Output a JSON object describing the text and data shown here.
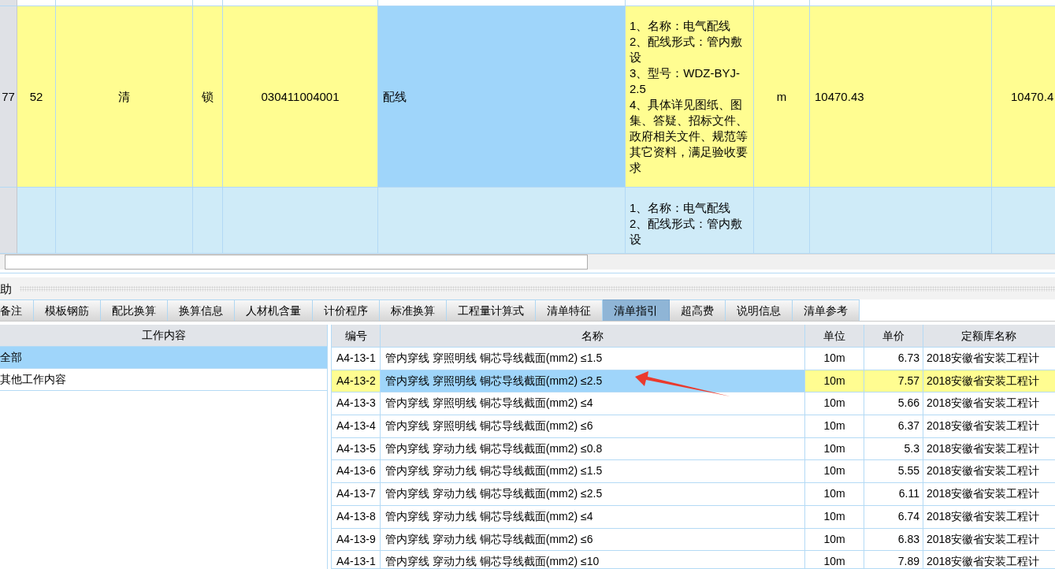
{
  "bill_rows": [
    {
      "row_number": "77",
      "current": true,
      "column_5_focused": true,
      "column_1": "52",
      "column_2": "清",
      "column_3": "锁",
      "column_4": "030411004001",
      "column_5": "配线",
      "column_6": [
        "1、名称：电气配线",
        "2、配线形式：管内敷设",
        "3、型号：WDZ-BYJ-2.5",
        "4、具体详见图纸、图集、答疑、招标文件、政府相关文件、规范等其它资料，满足验收要求"
      ],
      "column_7": "m",
      "column_8": "10470.43",
      "column_9": "10470.4"
    },
    {
      "current": false,
      "column_5_focused": false,
      "column_6": [
        "1、名称：电气配线",
        "2、配线形式：管内敷设"
      ]
    }
  ],
  "assist_panel": {
    "title": "助",
    "tabs": [
      {
        "label": "备注",
        "selected": false
      },
      {
        "label": "模板钢筋",
        "selected": false
      },
      {
        "label": "配比换算",
        "selected": false
      },
      {
        "label": "换算信息",
        "selected": false
      },
      {
        "label": "人材机含量",
        "selected": false
      },
      {
        "label": "计价程序",
        "selected": false
      },
      {
        "label": "标准换算",
        "selected": false
      },
      {
        "label": "工程量计算式",
        "selected": false
      },
      {
        "label": "清单特征",
        "selected": false
      },
      {
        "label": "清单指引",
        "selected": true
      },
      {
        "label": "超高费",
        "selected": false
      },
      {
        "label": "说明信息",
        "selected": false
      },
      {
        "label": "清单参考",
        "selected": false
      }
    ]
  },
  "work_content": {
    "header": "工作内容",
    "items": [
      {
        "label": "全部",
        "selected": true
      },
      {
        "label": "其他工作内容",
        "selected": false
      }
    ]
  },
  "quota_table": {
    "columns": [
      "编号",
      "名称",
      "单位",
      "单价",
      "定额库名称"
    ],
    "rows": [
      {
        "code": "A4-13-1",
        "name": "管内穿线 穿照明线 铜芯导线截面(mm2) ≤1.5",
        "unit": "10m",
        "price": "6.73",
        "library": "2018安徽省安装工程计",
        "selected": false,
        "name_focused": false
      },
      {
        "code": "A4-13-2",
        "name": "管内穿线 穿照明线 铜芯导线截面(mm2) ≤2.5",
        "unit": "10m",
        "price": "7.57",
        "library": "2018安徽省安装工程计",
        "selected": true,
        "name_focused": true
      },
      {
        "code": "A4-13-3",
        "name": "管内穿线 穿照明线 铜芯导线截面(mm2) ≤4",
        "unit": "10m",
        "price": "5.66",
        "library": "2018安徽省安装工程计",
        "selected": false,
        "name_focused": false
      },
      {
        "code": "A4-13-4",
        "name": "管内穿线 穿照明线 铜芯导线截面(mm2) ≤6",
        "unit": "10m",
        "price": "6.37",
        "library": "2018安徽省安装工程计",
        "selected": false,
        "name_focused": false
      },
      {
        "code": "A4-13-5",
        "name": "管内穿线 穿动力线 铜芯导线截面(mm2) ≤0.8",
        "unit": "10m",
        "price": "5.3",
        "library": "2018安徽省安装工程计",
        "selected": false,
        "name_focused": false
      },
      {
        "code": "A4-13-6",
        "name": "管内穿线 穿动力线 铜芯导线截面(mm2) ≤1.5",
        "unit": "10m",
        "price": "5.55",
        "library": "2018安徽省安装工程计",
        "selected": false,
        "name_focused": false
      },
      {
        "code": "A4-13-7",
        "name": "管内穿线 穿动力线 铜芯导线截面(mm2) ≤2.5",
        "unit": "10m",
        "price": "6.11",
        "library": "2018安徽省安装工程计",
        "selected": false,
        "name_focused": false
      },
      {
        "code": "A4-13-8",
        "name": "管内穿线 穿动力线 铜芯导线截面(mm2) ≤4",
        "unit": "10m",
        "price": "6.74",
        "library": "2018安徽省安装工程计",
        "selected": false,
        "name_focused": false
      },
      {
        "code": "A4-13-9",
        "name": "管内穿线 穿动力线 铜芯导线截面(mm2) ≤6",
        "unit": "10m",
        "price": "6.83",
        "library": "2018安徽省安装工程计",
        "selected": false,
        "name_focused": false
      },
      {
        "code": "A4-13-1",
        "name": "管内穿线 穿动力线 铜芯导线截面(mm2) ≤10",
        "unit": "10m",
        "price": "7.89",
        "library": "2018安徽省安装工程计",
        "selected": false,
        "name_focused": false
      }
    ]
  }
}
